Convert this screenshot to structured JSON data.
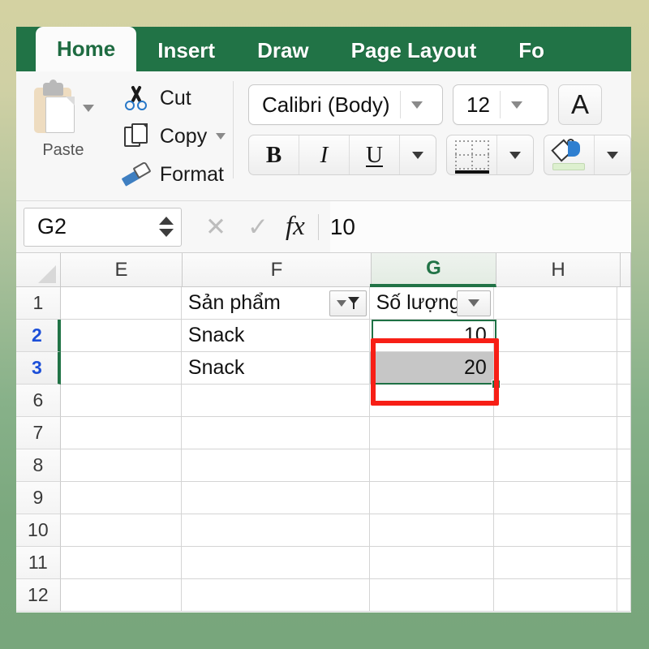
{
  "app": {
    "name": "Microsoft Excel",
    "accent_green": "#217346",
    "selection_green": "#1e7145",
    "annotation_red": "#f71f16"
  },
  "ribbon": {
    "tabs": [
      {
        "label": "Home",
        "active": true
      },
      {
        "label": "Insert",
        "active": false
      },
      {
        "label": "Draw",
        "active": false
      },
      {
        "label": "Page Layout",
        "active": false
      },
      {
        "label": "Fo",
        "active": false
      }
    ],
    "clipboard": {
      "paste_label": "Paste",
      "paste_icon": "clipboard-icon",
      "paste_dropdown_icon": "chevron-down-icon",
      "commands": [
        {
          "label": "Cut",
          "icon": "scissors-icon",
          "has_dropdown": false
        },
        {
          "label": "Copy",
          "icon": "copy-pages-icon",
          "has_dropdown": true
        },
        {
          "label": "Format",
          "icon": "format-painter-icon",
          "has_dropdown": false
        }
      ]
    },
    "font": {
      "font_name": "Calibri (Body)",
      "font_size": "12",
      "grow_font_label": "A",
      "bold_label": "B",
      "italic_label": "I",
      "underline_label": "U",
      "borders_icon": "borders-icon",
      "fill_color_icon": "fill-color-icon",
      "dropdown_icon": "chevron-down-icon"
    }
  },
  "formula_bar": {
    "name_box_value": "G2",
    "name_box_spinner_icon": "spinner-arrows-icon",
    "cancel_icon": "cancel-x-icon",
    "enter_icon": "enter-check-icon",
    "function_icon": "fx-icon",
    "formula_value": "10"
  },
  "sheet": {
    "columns": [
      {
        "label": "E",
        "selected": false
      },
      {
        "label": "F",
        "selected": false
      },
      {
        "label": "G",
        "selected": true
      },
      {
        "label": "H",
        "selected": false
      }
    ],
    "rows": [
      {
        "number": "1",
        "selected": false,
        "cells": [
          {
            "col": "E",
            "value": "",
            "align": "left",
            "shaded": false
          },
          {
            "col": "F",
            "value": "Sản phẩm",
            "align": "left",
            "shaded": false,
            "filter": "applied"
          },
          {
            "col": "G",
            "value": "Số lượng",
            "align": "left",
            "shaded": false,
            "filter": "plain"
          },
          {
            "col": "H",
            "value": "",
            "align": "left",
            "shaded": false
          }
        ]
      },
      {
        "number": "2",
        "selected": true,
        "cells": [
          {
            "col": "E",
            "value": "",
            "align": "left",
            "shaded": false
          },
          {
            "col": "F",
            "value": "Snack",
            "align": "left",
            "shaded": false
          },
          {
            "col": "G",
            "value": "10",
            "align": "right",
            "shaded": false
          },
          {
            "col": "H",
            "value": "",
            "align": "left",
            "shaded": false
          }
        ]
      },
      {
        "number": "3",
        "selected": true,
        "cells": [
          {
            "col": "E",
            "value": "",
            "align": "left",
            "shaded": false
          },
          {
            "col": "F",
            "value": "Snack",
            "align": "left",
            "shaded": false
          },
          {
            "col": "G",
            "value": "20",
            "align": "right",
            "shaded": true
          },
          {
            "col": "H",
            "value": "",
            "align": "left",
            "shaded": false
          }
        ]
      },
      {
        "number": "6",
        "selected": false,
        "cells": [
          {
            "col": "E",
            "value": ""
          },
          {
            "col": "F",
            "value": ""
          },
          {
            "col": "G",
            "value": ""
          },
          {
            "col": "H",
            "value": ""
          }
        ]
      },
      {
        "number": "7",
        "selected": false,
        "cells": [
          {
            "col": "E",
            "value": ""
          },
          {
            "col": "F",
            "value": ""
          },
          {
            "col": "G",
            "value": ""
          },
          {
            "col": "H",
            "value": ""
          }
        ]
      },
      {
        "number": "8",
        "selected": false,
        "cells": [
          {
            "col": "E",
            "value": ""
          },
          {
            "col": "F",
            "value": ""
          },
          {
            "col": "G",
            "value": ""
          },
          {
            "col": "H",
            "value": ""
          }
        ]
      },
      {
        "number": "9",
        "selected": false,
        "cells": [
          {
            "col": "E",
            "value": ""
          },
          {
            "col": "F",
            "value": ""
          },
          {
            "col": "G",
            "value": ""
          },
          {
            "col": "H",
            "value": ""
          }
        ]
      },
      {
        "number": "10",
        "selected": false,
        "cells": [
          {
            "col": "E",
            "value": ""
          },
          {
            "col": "F",
            "value": ""
          },
          {
            "col": "G",
            "value": ""
          },
          {
            "col": "H",
            "value": ""
          }
        ]
      },
      {
        "number": "11",
        "selected": false,
        "cells": [
          {
            "col": "E",
            "value": ""
          },
          {
            "col": "F",
            "value": ""
          },
          {
            "col": "G",
            "value": ""
          },
          {
            "col": "H",
            "value": ""
          }
        ]
      },
      {
        "number": "12",
        "selected": false,
        "cells": [
          {
            "col": "E",
            "value": ""
          },
          {
            "col": "F",
            "value": ""
          },
          {
            "col": "G",
            "value": ""
          },
          {
            "col": "H",
            "value": ""
          }
        ]
      }
    ],
    "active_cell": "G2",
    "selected_range": "G2:G3",
    "hidden_rows_note": "4-5"
  },
  "annotation": {
    "shape": "rectangle",
    "color": "#f71f16",
    "target_range": "G2:G3"
  }
}
